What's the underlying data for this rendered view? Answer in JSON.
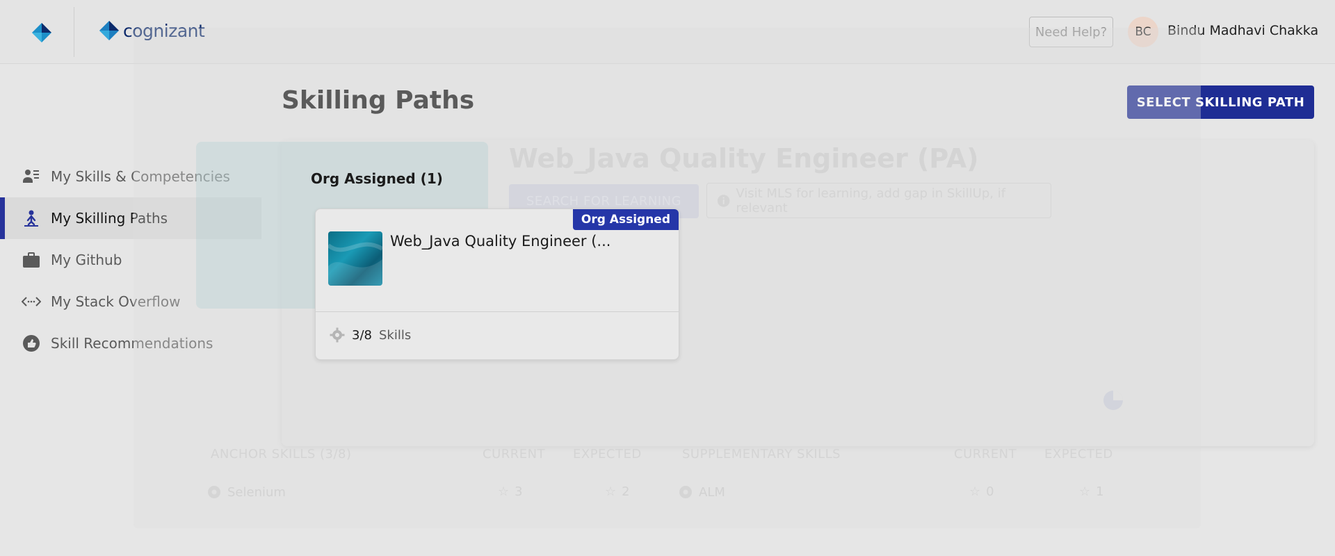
{
  "header": {
    "brand_text": "cognizant",
    "help_label": "Need Help?",
    "avatar_initials": "BC",
    "user_name": "Bindu Madhavi Chakka"
  },
  "sidebar": {
    "items": [
      {
        "label": "My Skills & Competencies",
        "icon": "people-skills-icon",
        "active": false
      },
      {
        "label": "My Skilling Paths",
        "icon": "person-path-icon",
        "active": true
      },
      {
        "label": "My Github",
        "icon": "briefcase-icon",
        "active": false
      },
      {
        "label": "My Stack Overflow",
        "icon": "code-arrows-icon",
        "active": false
      },
      {
        "label": "Skill Recommendations",
        "icon": "thumbs-up-icon",
        "active": false
      }
    ]
  },
  "main": {
    "title": "Skilling Paths",
    "select_button": "SELECT SKILLING PATH",
    "org_heading": "Org Assigned (1)",
    "card": {
      "badge": "Org Assigned",
      "title": "Web_Java Quality Engineer (...",
      "skills_count": "3/8",
      "skills_label": "Skills"
    }
  },
  "detail": {
    "title": "Web_Java Quality Engineer (PA)",
    "search_button": "SEARCH FOR LEARNING",
    "info_note": "Visit MLS for learning, add gap in SkillUp, if relevant",
    "anchor_header": "ANCHOR SKILLS (3/8)",
    "current_header": "CURRENT",
    "expected_header": "EXPECTED",
    "supp_header": "SUPPLEMENTARY SKILLS",
    "anchor_skill": {
      "name": "Selenium",
      "current": "3",
      "expected": "2"
    },
    "supp_skill": {
      "name": "ALM",
      "current": "0",
      "expected": "1"
    }
  },
  "colors": {
    "primary": "#1f2d94",
    "badge": "#2536a8",
    "active_bar": "#27339b",
    "brand": "#0c2a6b"
  }
}
